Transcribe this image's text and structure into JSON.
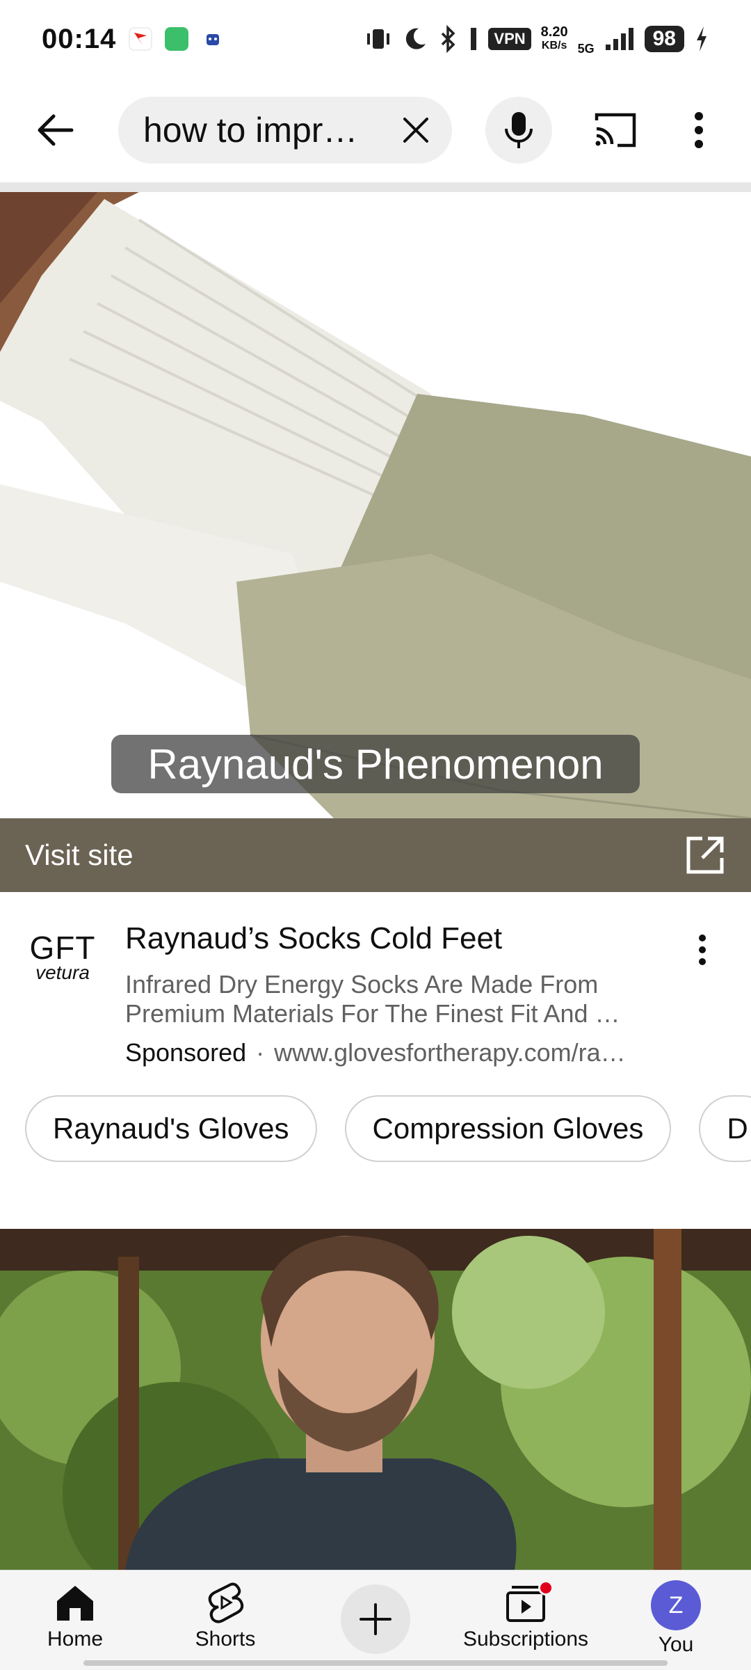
{
  "status_bar": {
    "time": "00:14",
    "vpn": "VPN",
    "speed_value": "8.20",
    "speed_unit": "KB/s",
    "network": "5G",
    "battery": "98"
  },
  "top_bar": {
    "search_text": "how to impr…"
  },
  "ad": {
    "caption": "Raynaud's Phenomenon",
    "visit_label": "Visit site",
    "logo_main": "GFT",
    "logo_sub": "vetura",
    "title": "Raynaud’s Socks Cold Feet",
    "description_line1": "Infrared Dry Energy Socks Are Made From",
    "description_line2": "Premium Materials For The Finest Fit And …",
    "sponsored": "Sponsored",
    "dot": "·",
    "url": "www.glovesfortherapy.com/ra…"
  },
  "chips": [
    {
      "label": "Raynaud's Gloves"
    },
    {
      "label": "Compression Gloves"
    },
    {
      "label": "D"
    }
  ],
  "bottom_nav": {
    "home": "Home",
    "shorts": "Shorts",
    "subscriptions": "Subscriptions",
    "you": "You",
    "avatar_letter": "Z"
  },
  "colors": {
    "visit_bar": "#6b6354",
    "avatar": "#5b5bd6",
    "notification_dot": "#e0001b"
  },
  "icons": {
    "back": "arrow-left-icon",
    "clear": "close-icon",
    "mic": "microphone-icon",
    "cast": "cast-icon",
    "more": "more-vertical-icon",
    "open_external": "open-external-icon",
    "home": "home-icon",
    "shorts": "shorts-icon",
    "create": "plus-icon",
    "subscriptions": "subscriptions-icon"
  }
}
